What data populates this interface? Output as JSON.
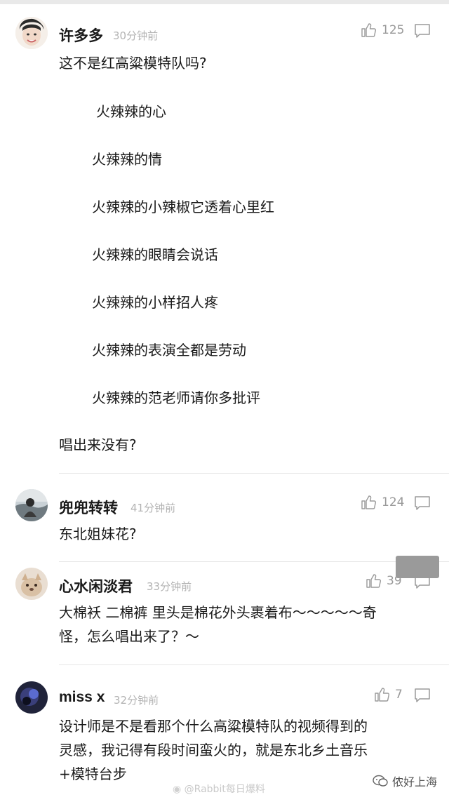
{
  "comments": [
    {
      "username": "许多多",
      "time": "30分钟前",
      "likes": "125",
      "text_intro": "这不是红高粱模特队吗?",
      "lyrics": [
        "火辣辣的心",
        "火辣辣的情",
        "火辣辣的小辣椒它透着心里红",
        "火辣辣的眼睛会说话",
        "火辣辣的小样招人疼",
        "火辣辣的表演全都是劳动",
        "火辣辣的范老师请你多批评"
      ],
      "text_outro": "唱出来没有?"
    },
    {
      "username": "兜兜转转",
      "time": "41分钟前",
      "likes": "124",
      "text": "东北姐妹花?"
    },
    {
      "username": "心水闲淡君",
      "time": "33分钟前",
      "likes": "39",
      "text_line1": "大棉袄 二棉裤 里头是棉花外头裹着布～～～～～奇",
      "text_line2": "怪，怎么唱出来了？～"
    },
    {
      "username": "miss x",
      "time": "32分钟前",
      "likes": "7",
      "text_line1": "设计师是不是看那个什么高粱模特队的视频得到的",
      "text_line2": "灵感，我记得有段时间蛮火的，就是东北乡土音乐",
      "text_line3": "+模特台步"
    }
  ],
  "watermark": {
    "weibo": "@Rabbit每日爆料",
    "account": "侬好上海"
  },
  "icons": {
    "like": "thumbs-up-icon",
    "reply": "comment-bubble-icon"
  }
}
